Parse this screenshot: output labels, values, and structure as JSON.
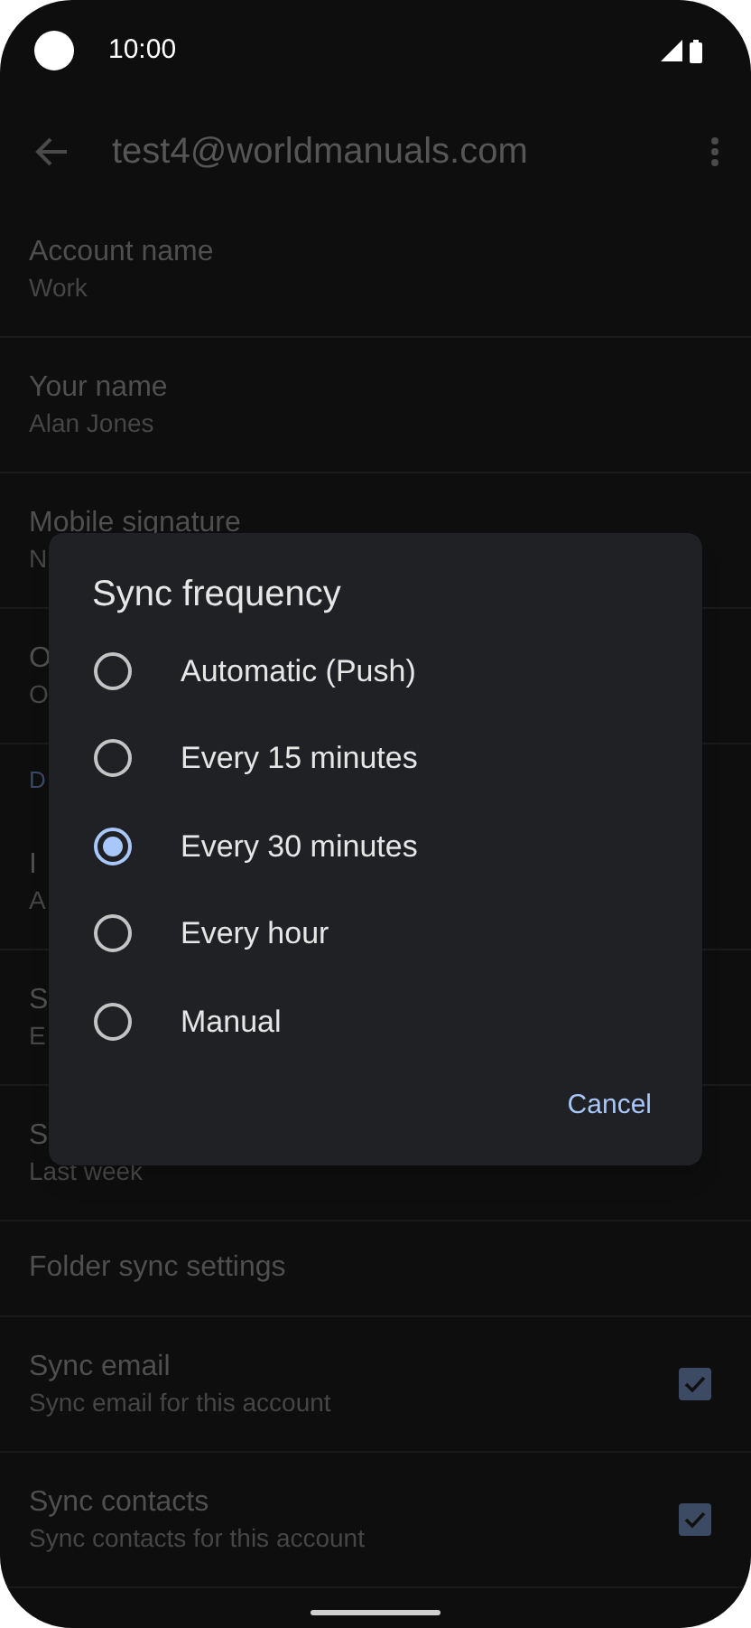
{
  "status_bar": {
    "time": "10:00"
  },
  "app_bar": {
    "title": "test4@worldmanuals.com"
  },
  "settings": [
    {
      "kind": "item",
      "title": "Account name",
      "subtitle": "Work"
    },
    {
      "kind": "item",
      "title": "Your name",
      "subtitle": "Alan Jones"
    },
    {
      "kind": "item",
      "title": "Mobile signature",
      "subtitle": "N"
    },
    {
      "kind": "item",
      "title": "O",
      "subtitle": "O"
    },
    {
      "kind": "header",
      "title": "D"
    },
    {
      "kind": "item",
      "title": "I",
      "subtitle": "A"
    },
    {
      "kind": "item",
      "title": "S",
      "subtitle": "E"
    },
    {
      "kind": "item",
      "title": "S",
      "subtitle": "Last week"
    },
    {
      "kind": "link",
      "title": "Folder sync settings"
    },
    {
      "kind": "checkbox",
      "title": "Sync email",
      "subtitle": "Sync email for this account",
      "checked": true
    },
    {
      "kind": "checkbox",
      "title": "Sync contacts",
      "subtitle": "Sync contacts for this account",
      "checked": true
    }
  ],
  "dialog": {
    "title": "Sync frequency",
    "options": [
      {
        "label": "Automatic (Push)",
        "selected": false
      },
      {
        "label": "Every 15 minutes",
        "selected": false
      },
      {
        "label": "Every 30 minutes",
        "selected": true
      },
      {
        "label": "Every hour",
        "selected": false
      },
      {
        "label": "Manual",
        "selected": false
      }
    ],
    "buttons": [
      "Cancel"
    ]
  }
}
